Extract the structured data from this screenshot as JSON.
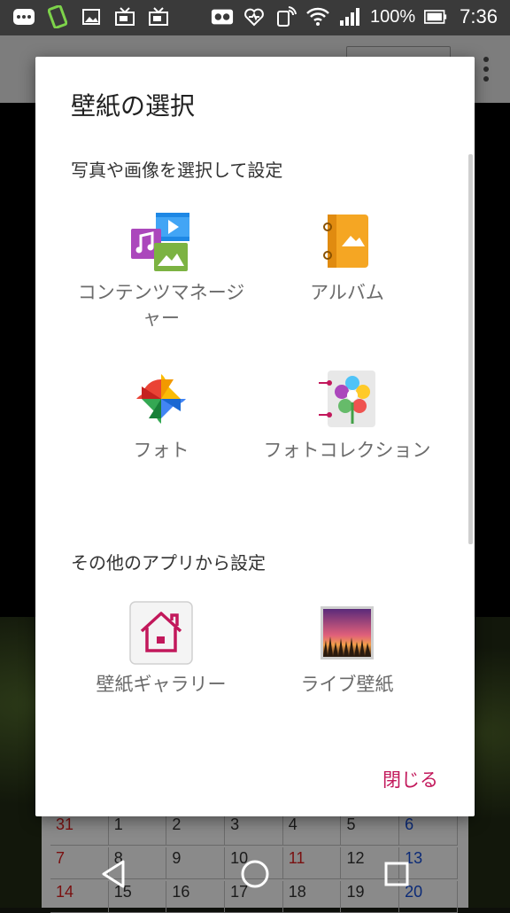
{
  "status_bar": {
    "battery_percent": "100%",
    "time": "7:36",
    "icons": [
      "more-icon",
      "rotate-icon",
      "image-icon",
      "tv-icon",
      "tv-icon",
      "voicemail-icon",
      "heart-signal-icon",
      "nfc-icon",
      "wifi-icon",
      "signal-icon",
      "battery-icon"
    ]
  },
  "dialog": {
    "title": "壁紙の選択",
    "section1_header": "写真や画像を選択して設定",
    "section1_items": [
      {
        "label": "コンテンツマネージャー",
        "icon": "content-manager-icon"
      },
      {
        "label": "アルバム",
        "icon": "album-icon"
      },
      {
        "label": "フォト",
        "icon": "photos-pinwheel-icon"
      },
      {
        "label": "フォトコレクション",
        "icon": "photo-collection-icon"
      }
    ],
    "section2_header": "その他のアプリから設定",
    "section2_items": [
      {
        "label": "壁紙ギャラリー",
        "icon": "wallpaper-gallery-house-icon"
      },
      {
        "label": "ライブ壁紙",
        "icon": "live-wallpaper-icon"
      }
    ],
    "close_label": "閉じる",
    "accent_color": "#c2185b"
  },
  "background_calendar": {
    "rows": [
      [
        "31",
        "1",
        "2",
        "3",
        "4",
        "5",
        "6"
      ],
      [
        "7",
        "8",
        "9",
        "10",
        "11",
        "12",
        "13"
      ],
      [
        "14",
        "15",
        "16",
        "17",
        "18",
        "19",
        "20"
      ]
    ]
  },
  "nav_bar": {
    "icons": [
      "back-icon",
      "home-icon",
      "recents-icon"
    ]
  }
}
